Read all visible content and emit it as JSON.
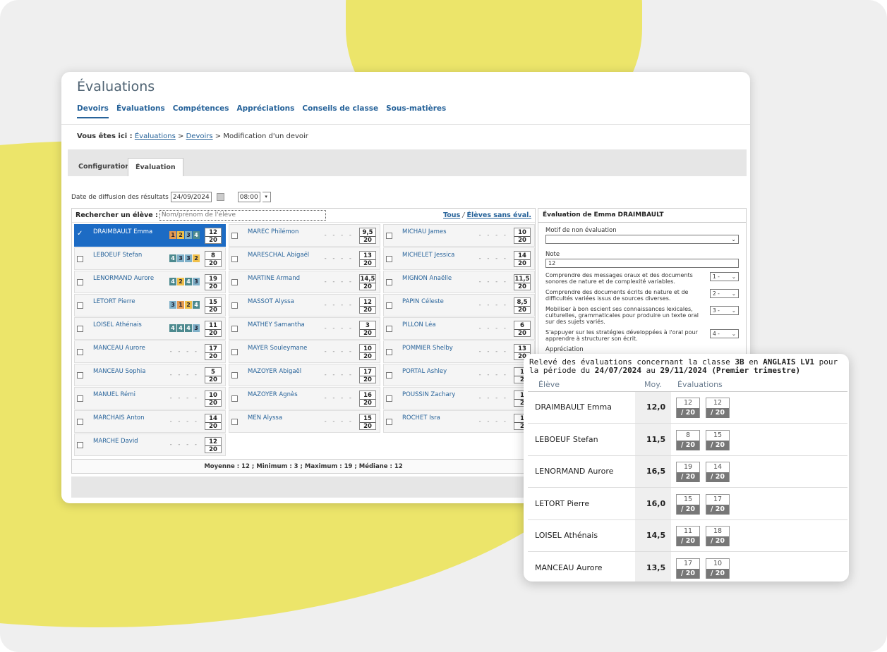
{
  "page": {
    "title": "Évaluations"
  },
  "nav": [
    "Devoirs",
    "Évaluations",
    "Compétences",
    "Appréciations",
    "Conseils de classe",
    "Sous-matières"
  ],
  "breadcrumb": {
    "prefix": "Vous êtes ici :",
    "link1": "Évaluations",
    "sep": ">",
    "link2": "Devoirs",
    "current": "Modification d'un devoir"
  },
  "tabs": [
    "Configuration",
    "Évaluation"
  ],
  "diffusion": {
    "label": "Date de diffusion des résultats",
    "date": "24/09/2024",
    "time": "08:00",
    "caret": "▾"
  },
  "search": {
    "label": "Rechercher un élève :",
    "placeholder": "Nom/prénom de l'élève",
    "all": "Tous",
    "slash": "/",
    "no_eval": "Élèves sans éval."
  },
  "students": [
    {
      "name": "DRAIMBAULT Emma",
      "comps": [
        "1",
        "2",
        "3",
        "4"
      ],
      "note": "12",
      "denom": "20",
      "selected": true,
      "check": "✓"
    },
    {
      "name": "LEBOEUF Stefan",
      "comps": [
        "4",
        "3",
        "3",
        "2"
      ],
      "note": "8",
      "denom": "20"
    },
    {
      "name": "LENORMAND Aurore",
      "comps": [
        "4",
        "2",
        "4",
        "3"
      ],
      "note": "19",
      "denom": "20"
    },
    {
      "name": "LETORT Pierre",
      "comps": [
        "3",
        "1",
        "2",
        "4"
      ],
      "note": "15",
      "denom": "20"
    },
    {
      "name": "LOISEL Athénais",
      "comps": [
        "4",
        "4",
        "4",
        "3"
      ],
      "note": "11",
      "denom": "20"
    },
    {
      "name": "MANCEAU Aurore",
      "dashes": "- - - -",
      "note": "17",
      "denom": "20"
    },
    {
      "name": "MANCEAU Sophia",
      "dashes": "- - - -",
      "note": "5",
      "denom": "20"
    },
    {
      "name": "MANUEL Rémi",
      "dashes": "- - - -",
      "note": "10",
      "denom": "20"
    },
    {
      "name": "MARCHAIS Anton",
      "dashes": "- - - -",
      "note": "14",
      "denom": "20"
    },
    {
      "name": "MARCHE David",
      "dashes": "- - - -",
      "note": "12",
      "denom": "20"
    },
    {
      "name": "MAREC Philémon",
      "dashes": "- - - -",
      "note": "9,5",
      "denom": "20"
    },
    {
      "name": "MARESCHAL Abigaël",
      "dashes": "- - - -",
      "note": "13",
      "denom": "20"
    },
    {
      "name": "MARTINE Armand",
      "dashes": "- - - -",
      "note": "14,5",
      "denom": "20"
    },
    {
      "name": "MASSOT Alyssa",
      "dashes": "- - - -",
      "note": "12",
      "denom": "20"
    },
    {
      "name": "MATHEY Samantha",
      "dashes": "- - - -",
      "note": "3",
      "denom": "20"
    },
    {
      "name": "MAYER Souleymane",
      "dashes": "- - - -",
      "note": "10",
      "denom": "20"
    },
    {
      "name": "MAZOYER Abigaël",
      "dashes": "- - - -",
      "note": "17",
      "denom": "20"
    },
    {
      "name": "MAZOYER Agnès",
      "dashes": "- - - -",
      "note": "16",
      "denom": "20"
    },
    {
      "name": "MEN Alyssa",
      "dashes": "- - - -",
      "note": "15",
      "denom": "20"
    },
    {
      "name": "MICHAU James",
      "dashes": "- - - -",
      "note": "10",
      "denom": "20"
    },
    {
      "name": "MICHELET Jessica",
      "dashes": "- - - -",
      "note": "14",
      "denom": "20"
    },
    {
      "name": "MIGNON Anaëlle",
      "dashes": "- - - -",
      "note": "11,5",
      "denom": "20"
    },
    {
      "name": "PAPIN Céleste",
      "dashes": "- - - -",
      "note": "8,5",
      "denom": "20"
    },
    {
      "name": "PILLON Léa",
      "dashes": "- - - -",
      "note": "6",
      "denom": "20"
    },
    {
      "name": "POMMIER Shelby",
      "dashes": "- - - -",
      "note": "13",
      "denom": "20"
    },
    {
      "name": "PORTAL Ashley",
      "dashes": "- - - -",
      "note": "1",
      "denom": "2"
    },
    {
      "name": "POUSSIN Zachary",
      "dashes": "- - - -",
      "note": "1",
      "denom": "2"
    },
    {
      "name": "ROCHET Isra",
      "dashes": "- - - -",
      "note": "1",
      "denom": "2"
    }
  ],
  "stats": "Moyenne : 12 ; Minimum : 3 ; Maximum : 19 ; Médiane : 12",
  "eval_panel": {
    "title": "Évaluation de Emma DRAIMBAULT",
    "motif_label": "Motif de non évaluation",
    "note_label": "Note",
    "note_value": "12",
    "competences": [
      {
        "text": "Comprendre des messages oraux et des documents sonores de nature et de complexité variables.",
        "value": "1 -"
      },
      {
        "text": "Comprendre des documents écrits de nature et de difficultés variées issus de sources diverses.",
        "value": "2 -"
      },
      {
        "text": "Mobiliser à bon escient ses connaissances lexicales, culturelles, grammaticales pour produire un texte oral sur des sujets variés.",
        "value": "3 -"
      },
      {
        "text": "S'appuyer sur les stratégies développées à l'oral pour apprendre à structurer son écrit.",
        "value": "4 -"
      }
    ],
    "appreciation_label": "Appréciation"
  },
  "releve": {
    "h1": "Relevé des évaluations concernant la classe",
    "classe": "3B",
    "h2": "en",
    "matiere": "ANGLAIS LV1",
    "h3": "pour la période du",
    "start": "24/07/2024",
    "h4": "au",
    "end": "29/11/2024",
    "periode": "(Premier trimestre)",
    "col_eleve": "Élève",
    "col_moy": "Moy.",
    "col_evals": "Évaluations",
    "rows": [
      {
        "name": "DRAIMBAULT Emma",
        "moy": "12,0",
        "evals": [
          {
            "n": "12",
            "d": "/ 20"
          },
          {
            "n": "12",
            "d": "/ 20"
          }
        ]
      },
      {
        "name": "LEBOEUF Stefan",
        "moy": "11,5",
        "evals": [
          {
            "n": "8",
            "d": "/ 20"
          },
          {
            "n": "15",
            "d": "/ 20"
          }
        ]
      },
      {
        "name": "LENORMAND Aurore",
        "moy": "16,5",
        "evals": [
          {
            "n": "19",
            "d": "/ 20"
          },
          {
            "n": "14",
            "d": "/ 20"
          }
        ]
      },
      {
        "name": "LETORT Pierre",
        "moy": "16,0",
        "evals": [
          {
            "n": "15",
            "d": "/ 20"
          },
          {
            "n": "17",
            "d": "/ 20"
          }
        ]
      },
      {
        "name": "LOISEL Athénais",
        "moy": "14,5",
        "evals": [
          {
            "n": "11",
            "d": "/ 20"
          },
          {
            "n": "18",
            "d": "/ 20"
          }
        ]
      },
      {
        "name": "MANCEAU Aurore",
        "moy": "13,5",
        "evals": [
          {
            "n": "17",
            "d": "/ 20"
          },
          {
            "n": "10",
            "d": "/ 20"
          }
        ]
      }
    ]
  },
  "colors": {
    "accent": "#27639a",
    "selected": "#1c6bc4",
    "yellow": "#ece56a"
  }
}
